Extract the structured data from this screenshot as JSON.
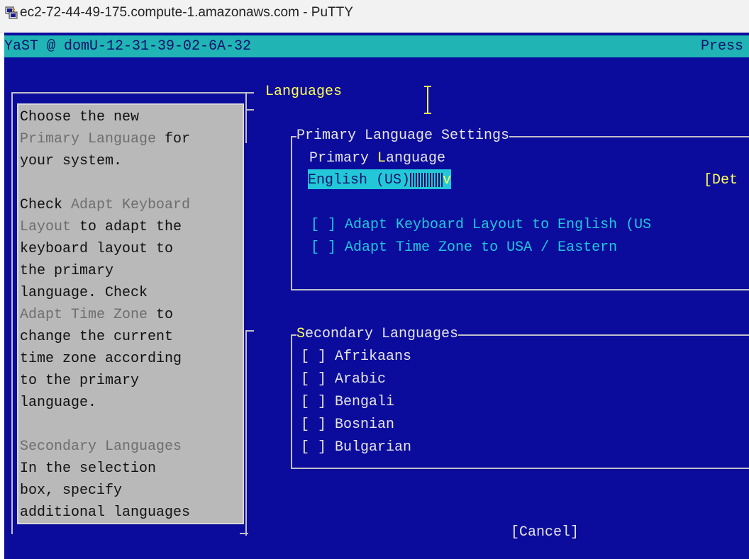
{
  "window": {
    "title": "ec2-72-44-49-175.compute-1.amazonaws.com - PuTTY",
    "icon": "putty-icon"
  },
  "statusbar": {
    "left": "YaST @ domU-12-31-39-02-6A-32",
    "right": "Press"
  },
  "page": {
    "heading": "Languages"
  },
  "help": {
    "lines": [
      {
        "segments": [
          {
            "t": "Choose the new",
            "c": "normal"
          }
        ]
      },
      {
        "segments": [
          {
            "t": "Primary Language",
            "c": "gray"
          },
          {
            "t": " for",
            "c": "normal"
          }
        ]
      },
      {
        "segments": [
          {
            "t": "your system.",
            "c": "normal"
          }
        ]
      },
      {
        "segments": [
          {
            "t": "",
            "c": "normal"
          }
        ]
      },
      {
        "segments": [
          {
            "t": "Check ",
            "c": "normal"
          },
          {
            "t": "Adapt Keyboard",
            "c": "gray"
          }
        ]
      },
      {
        "segments": [
          {
            "t": "Layout",
            "c": "gray"
          },
          {
            "t": " to adapt the",
            "c": "normal"
          }
        ]
      },
      {
        "segments": [
          {
            "t": "keyboard layout to",
            "c": "normal"
          }
        ]
      },
      {
        "segments": [
          {
            "t": "the primary",
            "c": "normal"
          }
        ]
      },
      {
        "segments": [
          {
            "t": "language. Check",
            "c": "normal"
          }
        ]
      },
      {
        "segments": [
          {
            "t": "Adapt Time Zone",
            "c": "gray"
          },
          {
            "t": " to",
            "c": "normal"
          }
        ]
      },
      {
        "segments": [
          {
            "t": "change the current",
            "c": "normal"
          }
        ]
      },
      {
        "segments": [
          {
            "t": "time zone according",
            "c": "normal"
          }
        ]
      },
      {
        "segments": [
          {
            "t": "to the primary",
            "c": "normal"
          }
        ]
      },
      {
        "segments": [
          {
            "t": "language.",
            "c": "normal"
          }
        ]
      },
      {
        "segments": [
          {
            "t": "",
            "c": "normal"
          }
        ]
      },
      {
        "segments": [
          {
            "t": "Secondary Languages",
            "c": "gray"
          }
        ]
      },
      {
        "segments": [
          {
            "t": "In the selection",
            "c": "normal"
          }
        ]
      },
      {
        "segments": [
          {
            "t": "box, specify",
            "c": "normal"
          }
        ]
      },
      {
        "segments": [
          {
            "t": "additional languages",
            "c": "normal"
          }
        ]
      }
    ]
  },
  "primary": {
    "frame_title_first": "P",
    "frame_title_rest": "rimary Language Settings",
    "label_prefix": "Primary ",
    "label_hotkey": "L",
    "label_rest": "anguage",
    "selected": "English (US)",
    "dropdown_glyph": "v",
    "details_button": "[Det",
    "checkboxes": [
      {
        "box": "[ ]",
        "label": "Adapt Keyboard Layout to English (US",
        "checked": false
      },
      {
        "box": "[ ]",
        "label": "Adapt Time Zone to USA / Eastern",
        "checked": false
      }
    ]
  },
  "secondary": {
    "frame_title_first": "S",
    "frame_title_rest": "econdary Languages",
    "items": [
      {
        "box": "[ ]",
        "label": "Afrikaans",
        "checked": false
      },
      {
        "box": "[ ]",
        "label": "Arabic",
        "checked": false
      },
      {
        "box": "[ ]",
        "label": "Bengali",
        "checked": false
      },
      {
        "box": "[ ]",
        "label": "Bosnian",
        "checked": false
      },
      {
        "box": "[ ]",
        "label": "Bulgarian",
        "checked": false
      }
    ]
  },
  "buttons": {
    "cancel": "[Cancel]"
  },
  "colors": {
    "terminal_bg": "#0c0c9c",
    "status_bg": "#20b4b4",
    "accent_yellow": "#ffff55",
    "accent_cyan": "#22c8d8",
    "help_bg": "#b9b9b9"
  }
}
